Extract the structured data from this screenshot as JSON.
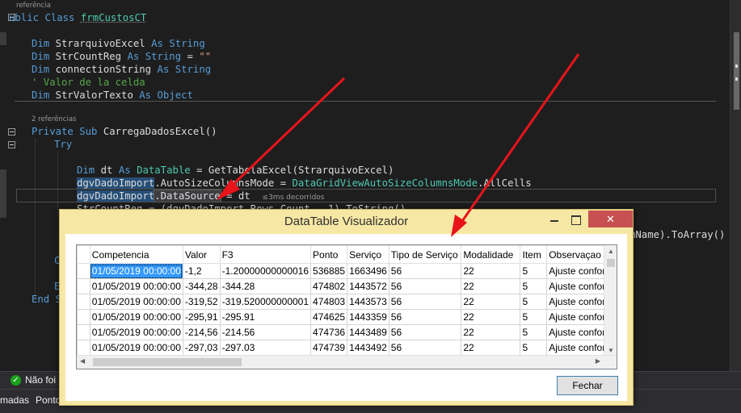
{
  "editor": {
    "references_1": "referência",
    "references_2": "2 referências",
    "line_class_prefix": "ublic",
    "line_class_kw": "Class",
    "line_class_name": "frmCustosCT",
    "dim1_name": "StrarquivoExcel",
    "dim2_name": "StrCountReg",
    "dim2_value": "\"\"",
    "dim3_name": "connectionString",
    "comment": "' Valor de la celda",
    "dim4_name": "StrValorTexto",
    "kw_dim": "Dim",
    "kw_as": "As",
    "kw_string": "String",
    "kw_object": "Object",
    "kw_private": "Private",
    "kw_sub": "Sub",
    "sub_name": "CarregaDadosExcel()",
    "kw_try": "Try",
    "dt_decl_name": "dt",
    "dt_type": "DataTable",
    "dt_assign": "= GetTabelaExcel(StrarquivoExcel)",
    "grid_var": "dgvDadoImport",
    "autosize_prop": ".AutoSizeColumnsMode = ",
    "autosize_enum": "DataGridViewAutoSizeColumnsMode",
    "autosize_value": ".AllCells",
    "datasource_prop": ".DataSource",
    "datasource_assign": " = dt",
    "elapsed_hint": "≤3ms decorridos",
    "line_partial": "StrCountReg = (dgvDadoImport.Rows.Count - 1).ToString()",
    "right_fragment": "mName).ToArray()",
    "end_c": "C",
    "end_e": "E",
    "end_s": "End S"
  },
  "status": {
    "ok_text": "Não foi"
  },
  "bottom_tabs": {
    "tab1": "madas",
    "tab2": "Ponto"
  },
  "dialog": {
    "title": "DataTable Visualizador",
    "close_glyph": "✕",
    "close_button": "Fechar"
  },
  "grid": {
    "columns": [
      "Competencia",
      "Valor",
      "F3",
      "Ponto",
      "Serviço",
      "Tipo de Serviço",
      "Modalidade",
      "Item",
      "Observaçao"
    ],
    "rows": [
      [
        "01/05/2019 00:00:00",
        "-1,2",
        "-1.20000000000016",
        "536885",
        "1663496",
        "56",
        "22",
        "5",
        "Ajuste conform"
      ],
      [
        "01/05/2019 00:00:00",
        "-344,28",
        "-344.28",
        "474802",
        "1443572",
        "56",
        "22",
        "5",
        "Ajuste conform"
      ],
      [
        "01/05/2019 00:00:00",
        "-319,52",
        "-319.520000000001",
        "474803",
        "1443573",
        "56",
        "22",
        "5",
        "Ajuste conform"
      ],
      [
        "01/05/2019 00:00:00",
        "-295,91",
        "-295.91",
        "474625",
        "1443359",
        "56",
        "22",
        "5",
        "Ajuste conform"
      ],
      [
        "01/05/2019 00:00:00",
        "-214,56",
        "-214.56",
        "474736",
        "1443489",
        "56",
        "22",
        "5",
        "Ajuste conform"
      ],
      [
        "01/05/2019 00:00:00",
        "-297,03",
        "-297.03",
        "474739",
        "1443492",
        "56",
        "22",
        "5",
        "Ajuste conform"
      ]
    ]
  },
  "colors": {
    "arrow": "#e8141a",
    "dialog_bg": "#f7e7a4",
    "selection": "#3399ff"
  }
}
